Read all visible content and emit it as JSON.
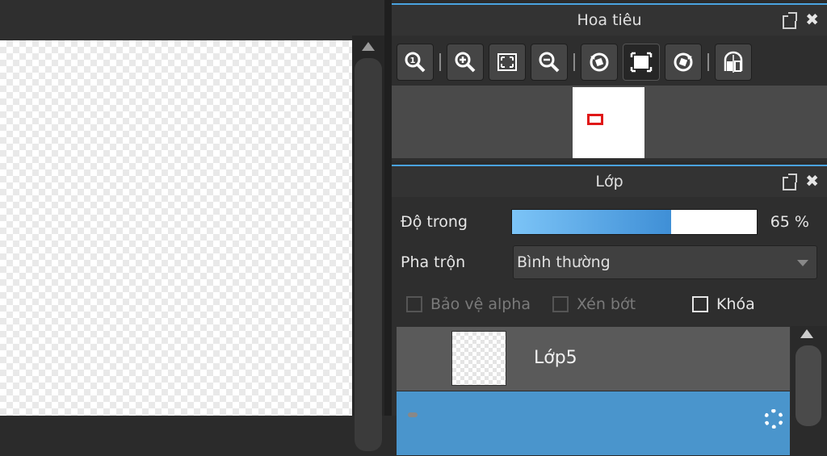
{
  "navigator": {
    "title": "Hoa tiêu",
    "toolbar": [
      "zoom-actual-icon",
      "zoom-in-icon",
      "fit-window-icon",
      "zoom-out-icon",
      "rotate-left-icon",
      "reset-view-icon",
      "rotate-right-icon",
      "flip-horizontal-icon"
    ]
  },
  "layers": {
    "title": "Lớp",
    "opacity_label": "Độ trong",
    "opacity_percent": 65,
    "opacity_value": "65 %",
    "blend_label": "Pha trộn",
    "blend_value": "Bình thường",
    "protect_alpha_label": "Bảo vệ alpha",
    "clipping_label": "Xén bớt",
    "lock_label": "Khóa",
    "items": [
      {
        "name": "Lớp5"
      }
    ]
  },
  "colors": {
    "accent": "#4aa3e0",
    "selected_layer": "#4a95cc",
    "viewport_marker": "#e01818"
  }
}
